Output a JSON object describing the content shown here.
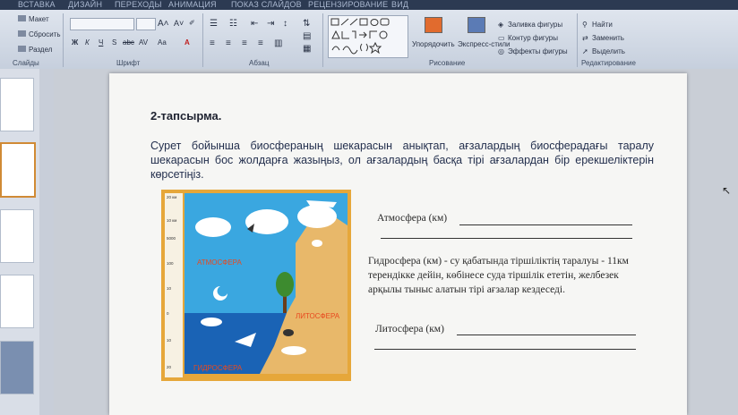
{
  "ribbon": {
    "tabs": [
      "ВСТАВКА",
      "ДИЗАЙН",
      "ПЕРЕХОДЫ",
      "АНИМАЦИЯ",
      "ПОКАЗ СЛАЙДОВ",
      "РЕЦЕНЗИРОВАНИЕ",
      "ВИД"
    ],
    "groups": {
      "slides": {
        "label": "Слайды",
        "layout": "Макет",
        "reset": "Сбросить",
        "section": "Раздел"
      },
      "font": {
        "label": "Шрифт",
        "bold": "Ж",
        "italic": "К",
        "underline": "Ч",
        "strike": "S",
        "abc": "abc",
        "spacing": "AV",
        "case": "Aa",
        "color": "A"
      },
      "paragraph": {
        "label": "Абзац"
      },
      "drawing": {
        "label": "Рисование",
        "arrange": "Упорядочить",
        "quick_styles": "Экспресс-стили",
        "fill": "Заливка фигуры",
        "outline": "Контур фигуры",
        "effects": "Эффекты фигуры"
      },
      "editing": {
        "label": "Редактирование",
        "find": "Найти",
        "replace": "Заменить",
        "select": "Выделить"
      }
    }
  },
  "slide": {
    "title": "2-тапсырма.",
    "instructions": "Сурет бойынша биосфераның шекарасын анықтап, ағзалардың биосферадағы таралу шекарасын бос жолдарға жазыңыз, ол ағзалардың басқа тірі ағзалардан бір ерекшеліктерін көрсетіңіз.",
    "atmosphere_line": "Атмосфера (км)",
    "hydrosphere_text": "Гидросфера (км) - су қабатында тіршіліктің таралуы - 11км терендікке дейін, көбінесе суда тіршілік ететін, желбезек арқылы тыныс алатын тірі ағзалар кездеседі.",
    "lithosphere_line": "Литосфера (км)",
    "diagram": {
      "label_atmosphere": "АТМОСФЕРА",
      "label_lithosphere": "ЛИТОСФЕРА",
      "label_hydrosphere": "ГИДРОСФЕРА",
      "scale": [
        "20 км",
        "10 км",
        "5000",
        "100",
        "10",
        "0",
        "10",
        "20"
      ],
      "colors": {
        "sky": "#3aa7e0",
        "sea": "#1a63b5",
        "land": "#e8b86a",
        "frame": "#e6a73a"
      }
    }
  }
}
